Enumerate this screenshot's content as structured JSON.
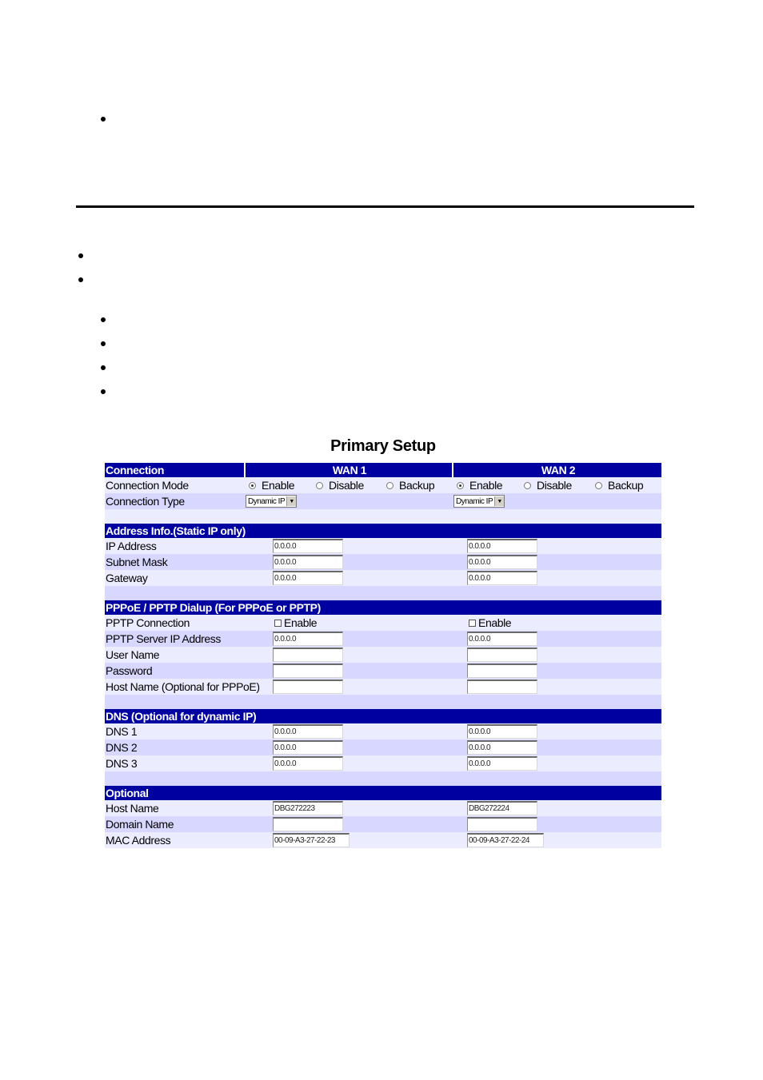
{
  "page": {
    "title": "Primary Setup",
    "colors": {
      "header": "#0000a0",
      "row_dark": "#d7d7ff",
      "row_light": "#ececff"
    }
  },
  "connection": {
    "header": "Connection",
    "wan1": "WAN 1",
    "wan2": "WAN 2",
    "mode_label": "Connection Mode",
    "mode_options": [
      "Enable",
      "Disable",
      "Backup"
    ],
    "wan1_mode": "Enable",
    "wan2_mode": "Enable",
    "type_label": "Connection Type",
    "wan1_type": "Dynamic IP",
    "wan2_type": "Dynamic IP"
  },
  "address": {
    "header": "Address Info.(Static IP only)",
    "rows": [
      {
        "label": "IP Address",
        "wan1": "0.0.0.0",
        "wan2": "0.0.0.0"
      },
      {
        "label": "Subnet Mask",
        "wan1": "0.0.0.0",
        "wan2": "0.0.0.0"
      },
      {
        "label": "Gateway",
        "wan1": "0.0.0.0",
        "wan2": "0.0.0.0"
      }
    ]
  },
  "pppoe": {
    "header": "PPPoE / PPTP Dialup (For PPPoE or PPTP)",
    "pptp_label": "PPTP Connection",
    "enable_label": "Enable",
    "rows": [
      {
        "label": "PPTP Server IP Address",
        "wan1": "0.0.0.0",
        "wan2": "0.0.0.0"
      },
      {
        "label": "User Name",
        "wan1": "",
        "wan2": ""
      },
      {
        "label": "Password",
        "wan1": "",
        "wan2": ""
      },
      {
        "label": "Host Name (Optional for PPPoE)",
        "wan1": "",
        "wan2": ""
      }
    ]
  },
  "dns": {
    "header": "DNS (Optional for dynamic IP)",
    "rows": [
      {
        "label": "DNS 1",
        "wan1": "0.0.0.0",
        "wan2": "0.0.0.0"
      },
      {
        "label": "DNS 2",
        "wan1": "0.0.0.0",
        "wan2": "0.0.0.0"
      },
      {
        "label": "DNS 3",
        "wan1": "0.0.0.0",
        "wan2": "0.0.0.0"
      }
    ]
  },
  "optional": {
    "header": "Optional",
    "rows": [
      {
        "label": "Host Name",
        "wan1": "DBG272223",
        "wan2": "DBG272224"
      },
      {
        "label": "Domain Name",
        "wan1": "",
        "wan2": ""
      },
      {
        "label": "MAC Address",
        "wan1": "00-09-A3-27-22-23",
        "wan2": "00-09-A3-27-22-24"
      }
    ]
  }
}
